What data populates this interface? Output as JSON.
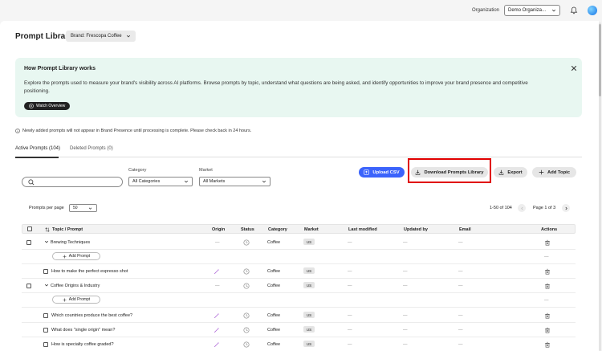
{
  "header": {
    "organization_label": "Organization",
    "organization_value": "Demo Organiza..."
  },
  "page": {
    "title": "Prompt Library",
    "brand_selector": "Brand: Frescopa Coffee"
  },
  "banner": {
    "title": "How Prompt Library works",
    "text": "Explore the prompts used to measure your brand's visibility across AI platforms. Browse prompts by topic, understand what questions are being asked, and identify opportunities to improve your brand presence and competitive positioning.",
    "watch_label": "Watch Overview"
  },
  "notice": "Newly added prompts will not appear in Brand Presence until processing is complete. Please check back in 24 hours.",
  "tabs": [
    {
      "label": "Active Prompts (104)"
    },
    {
      "label": "Deleted Prompts (0)"
    }
  ],
  "filters": {
    "category_label": "Category",
    "category_value": "All Categories",
    "market_label": "Market",
    "market_value": "All Markets"
  },
  "toolbar": {
    "upload_csv": "Upload CSV",
    "download_library": "Download Prompts Library",
    "export": "Export",
    "add_topic": "Add Topic"
  },
  "pagination": {
    "per_page_label": "Prompts per page",
    "per_page_value": "50",
    "range": "1-50 of 104",
    "page": "Page 1 of 3"
  },
  "table": {
    "headers": {
      "topic": "Topic / Prompt",
      "origin": "Origin",
      "status": "Status",
      "category": "Category",
      "market": "Market",
      "last_modified": "Last modified",
      "updated_by": "Updated by",
      "email": "Email",
      "actions": "Actions"
    },
    "add_prompt_label": "Add Prompt",
    "dash": "—",
    "topics": [
      {
        "name": "Brewing Techniques",
        "category": "Coffee",
        "prompts": [
          {
            "text": "How to make the perfect espresso shot",
            "category": "Coffee",
            "market": "US"
          }
        ]
      },
      {
        "name": "Coffee Origins & Industry",
        "category": "Coffee",
        "prompts": [
          {
            "text": "Which countries produce the best coffee?",
            "category": "Coffee",
            "market": "US"
          },
          {
            "text": "What does \"single origin\" mean?",
            "category": "Coffee",
            "market": "US"
          },
          {
            "text": "How is specialty coffee graded?",
            "category": "Coffee",
            "market": "US"
          }
        ]
      }
    ],
    "topic_market": "US"
  }
}
